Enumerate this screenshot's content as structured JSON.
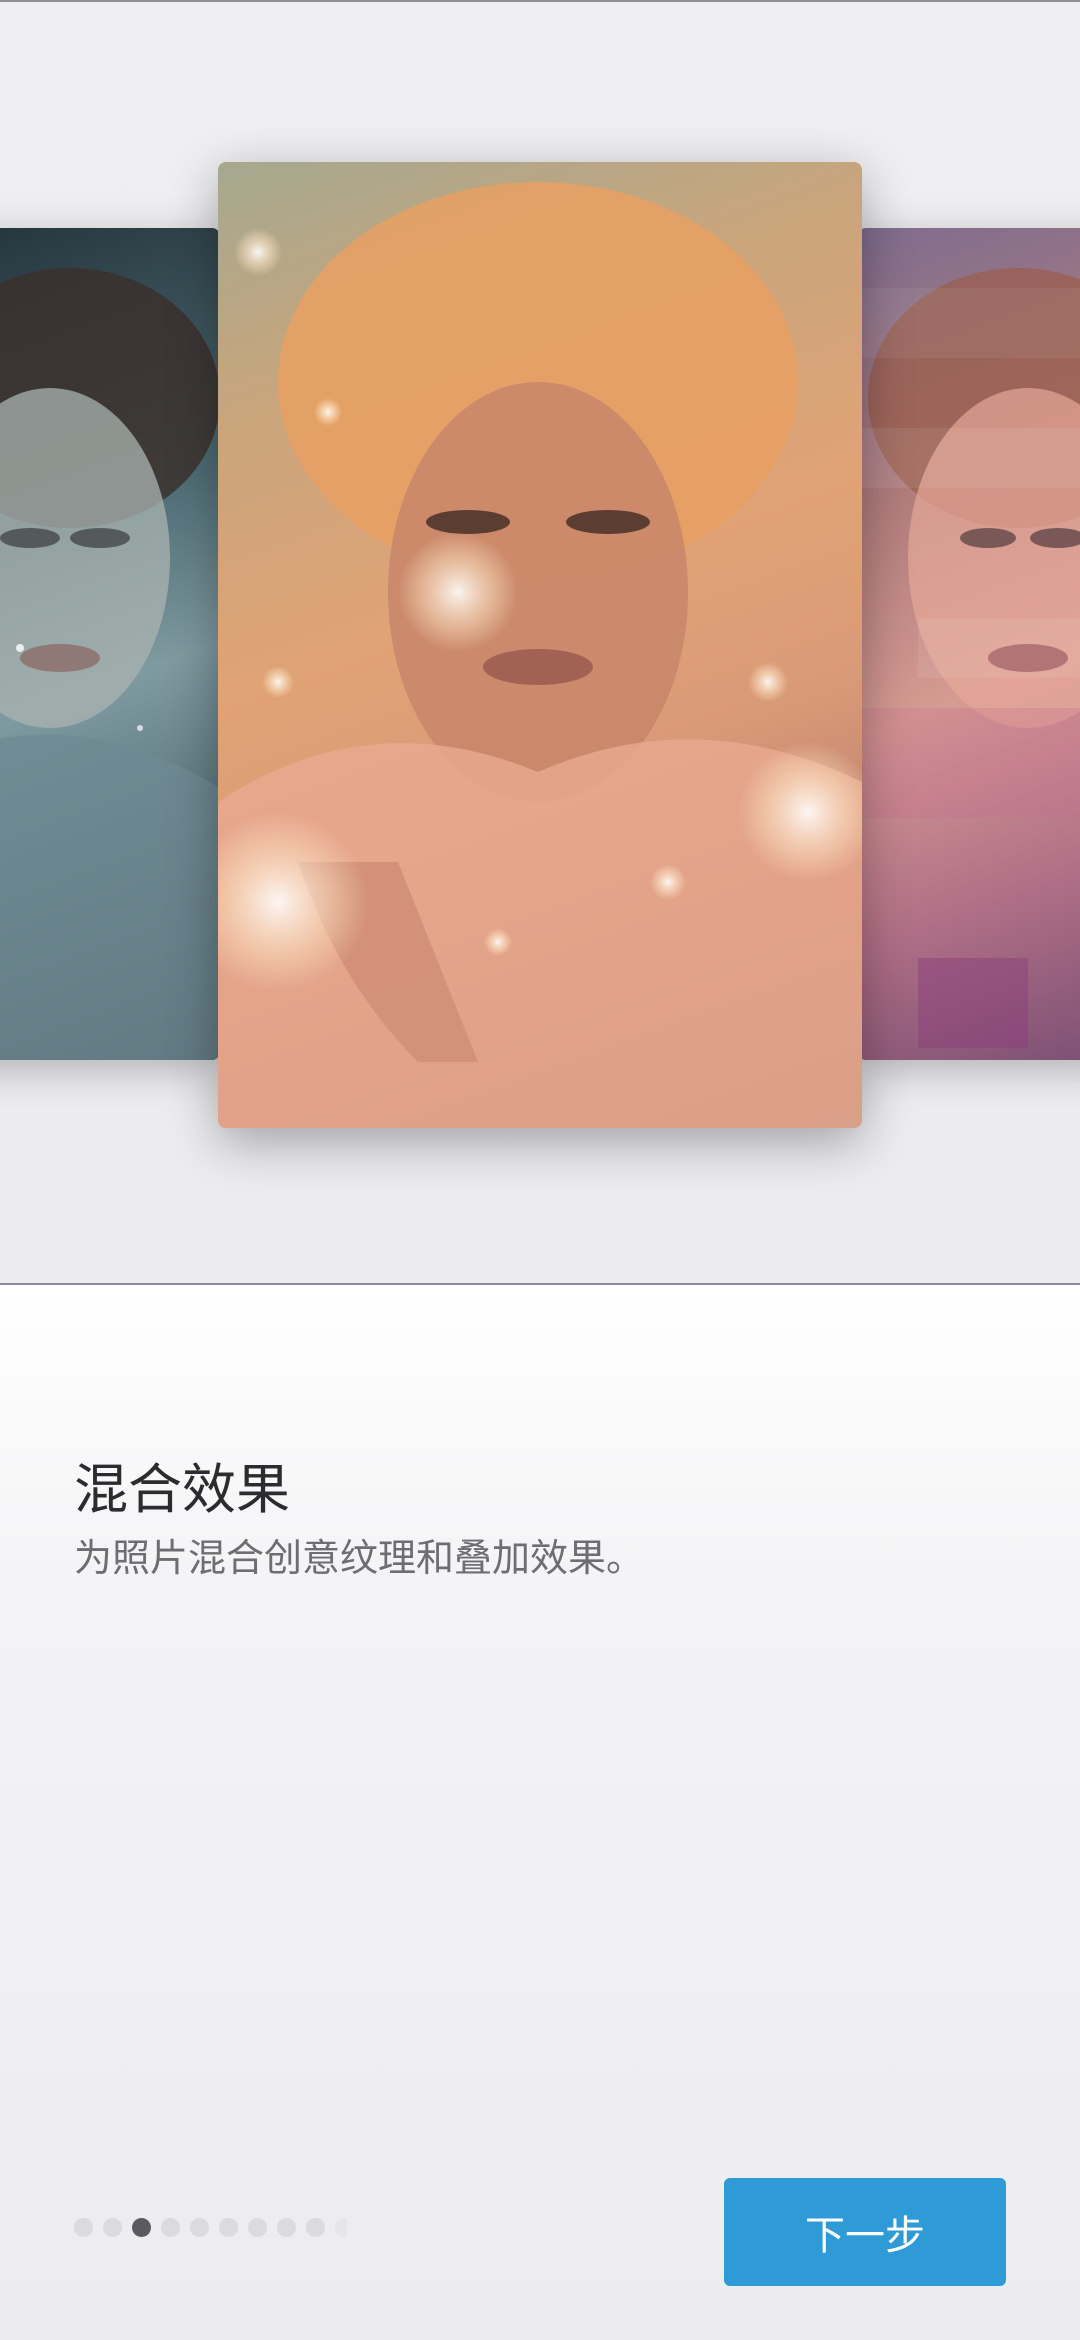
{
  "onboarding": {
    "title": "混合效果",
    "description": "为照片混合创意纹理和叠加效果。",
    "next_label": "下一步",
    "page_count": 10,
    "current_page": 3
  },
  "images": [
    {
      "name": "woman-portrait-teal-filter"
    },
    {
      "name": "woman-portrait-bokeh-blend"
    },
    {
      "name": "woman-portrait-pink-texture"
    }
  ],
  "colors": {
    "primary": "#2e9ad6",
    "dot_active": "#5a5a60",
    "dot_inactive": "#dadadf"
  }
}
